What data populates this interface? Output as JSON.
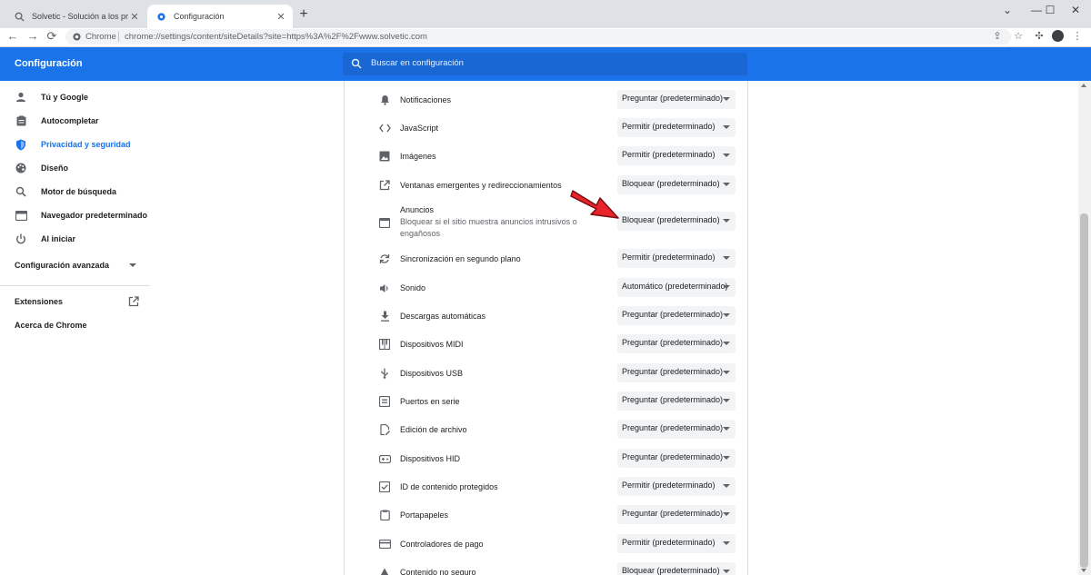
{
  "tabs": [
    {
      "title": "Solvetic - Solución a los problem",
      "close": "✕"
    },
    {
      "title": "Configuración",
      "close": "✕"
    }
  ],
  "new_tab": "+",
  "window_controls": {
    "minimize": "—",
    "maximize": "☐",
    "close": "✕"
  },
  "toolbar": {
    "back": "←",
    "forward": "→",
    "reload": "⟳",
    "site_label": "Chrome",
    "url": "chrome://settings/content/siteDetails?site=https%3A%2F%2Fwww.solvetic.com"
  },
  "header": {
    "title": "Configuración",
    "search_placeholder": "Buscar en configuración"
  },
  "sidebar": {
    "items": [
      {
        "label": "Tú y Google",
        "icon": "person-icon",
        "active": false
      },
      {
        "label": "Autocompletar",
        "icon": "clipboard-icon",
        "active": false
      },
      {
        "label": "Privacidad y seguridad",
        "icon": "shield-icon",
        "active": true
      },
      {
        "label": "Diseño",
        "icon": "palette-icon",
        "active": false
      },
      {
        "label": "Motor de búsqueda",
        "icon": "search-icon",
        "active": false
      },
      {
        "label": "Navegador predeterminado",
        "icon": "browser-icon",
        "active": false
      },
      {
        "label": "Al iniciar",
        "icon": "power-icon",
        "active": false
      }
    ],
    "advanced": "Configuración avanzada",
    "extensions": "Extensiones",
    "about": "Acerca de Chrome"
  },
  "permissions": [
    {
      "label": "Notificaciones",
      "icon": "bell-icon",
      "value": "Preguntar (predeterminado)"
    },
    {
      "label": "JavaScript",
      "icon": "code-icon",
      "value": "Permitir (predeterminado)"
    },
    {
      "label": "Imágenes",
      "icon": "image-icon",
      "value": "Permitir (predeterminado)"
    },
    {
      "label": "Ventanas emergentes y redireccionamientos",
      "icon": "open-in-new-icon",
      "value": "Bloquear (predeterminado)"
    },
    {
      "label": "Anuncios",
      "sublabel": "Bloquear si el sitio muestra anuncios intrusivos o engañosos",
      "icon": "ads-window-icon",
      "value": "Bloquear (predeterminado)"
    },
    {
      "label": "Sincronización en segundo plano",
      "icon": "sync-icon",
      "value": "Permitir (predeterminado)"
    },
    {
      "label": "Sonido",
      "icon": "volume-icon",
      "value": "Automático (predeterminado)"
    },
    {
      "label": "Descargas automáticas",
      "icon": "download-icon",
      "value": "Preguntar (predeterminado)"
    },
    {
      "label": "Dispositivos MIDI",
      "icon": "piano-icon",
      "value": "Preguntar (predeterminado)"
    },
    {
      "label": "Dispositivos USB",
      "icon": "usb-icon",
      "value": "Preguntar (predeterminado)"
    },
    {
      "label": "Puertos en serie",
      "icon": "serial-port-icon",
      "value": "Preguntar (predeterminado)"
    },
    {
      "label": "Edición de archivo",
      "icon": "file-edit-icon",
      "value": "Preguntar (predeterminado)"
    },
    {
      "label": "Dispositivos HID",
      "icon": "gamepad-icon",
      "value": "Preguntar (predeterminado)"
    },
    {
      "label": "ID de contenido protegidos",
      "icon": "checkbox-icon",
      "value": "Permitir (predeterminado)"
    },
    {
      "label": "Portapapeles",
      "icon": "clipboard-icon",
      "value": "Preguntar (predeterminado)"
    },
    {
      "label": "Controladores de pago",
      "icon": "credit-card-icon",
      "value": "Permitir (predeterminado)"
    },
    {
      "label": "Contenido no seguro",
      "icon": "warning-icon",
      "value": "Bloquear (predeterminado)"
    }
  ],
  "colors": {
    "accent": "#1a73e8",
    "annotation_arrow": "#e8232a"
  }
}
